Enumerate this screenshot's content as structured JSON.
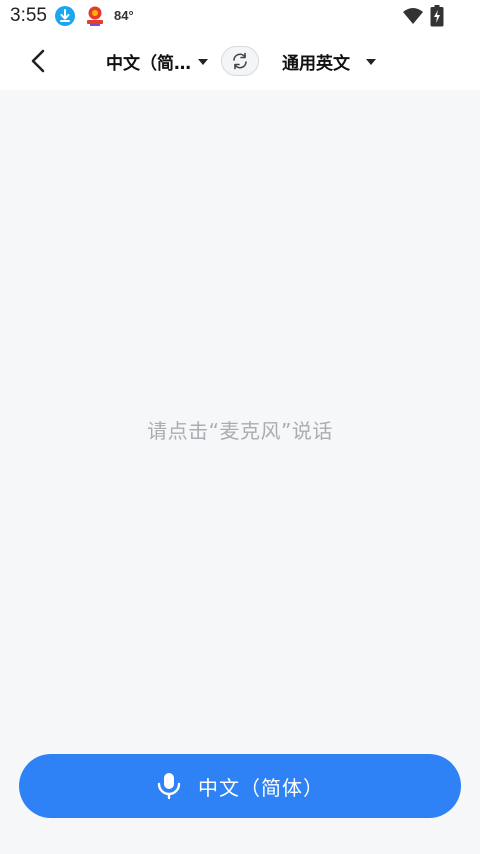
{
  "status_bar": {
    "time": "3:55",
    "temperature": "84°",
    "icons": [
      "download-icon",
      "app-notification-icon",
      "wifi-icon",
      "battery-charging-icon"
    ]
  },
  "top_bar": {
    "back_icon": "chevron-left-icon",
    "source_language": "中文（简…",
    "target_language": "通用英文",
    "swap_icon": "swap-arrows-icon"
  },
  "content": {
    "hint": "请点击“麦克风”说话"
  },
  "mic_button": {
    "icon": "microphone-icon",
    "label": "中文（简体）"
  },
  "colors": {
    "accent": "#2e82f5",
    "background": "#f6f7f9",
    "hint_text": "#a9adb3",
    "download_badge": "#1aa7f0"
  }
}
